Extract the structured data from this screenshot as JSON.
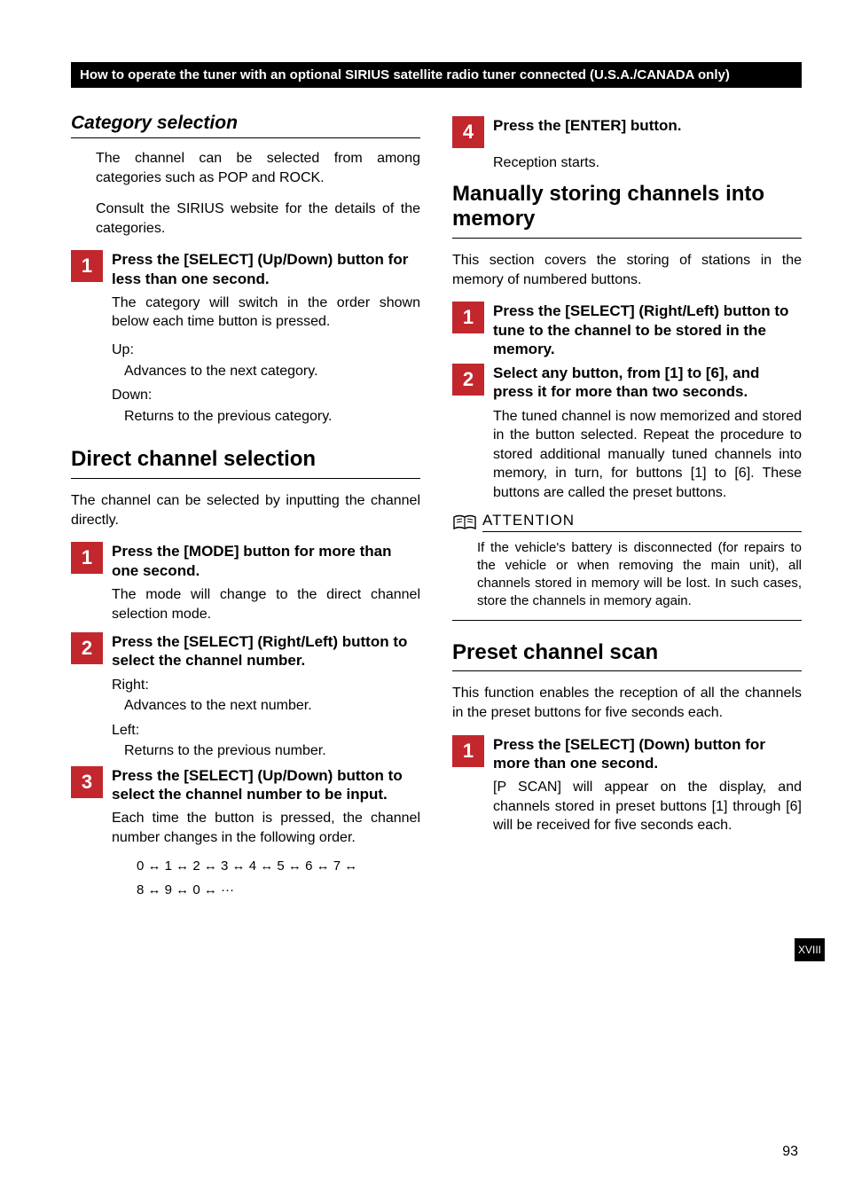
{
  "header": "How to operate the tuner with an optional SIRIUS satellite radio tuner connected (U.S.A./CANADA only)",
  "side_tab": "XVIII",
  "page_number": "93",
  "arrow": "↔",
  "left": {
    "category_selection": {
      "title": "Category selection",
      "intro": "The channel can be selected from among categories such as POP and ROCK.",
      "intro2": "Consult the SIRIUS website for the details of the categories.",
      "step1_num": "1",
      "step1_label": "Press the [SELECT] (Up/Down) button for less than one second.",
      "step1_body": "The category will switch in the order shown below each time button is pressed.",
      "up_label": "Up:",
      "up_body": "Advances to the next category.",
      "down_label": "Down:",
      "down_body": "Returns to the previous category."
    },
    "direct": {
      "title": "Direct channel selection",
      "intro": "The channel can be selected by inputting the channel directly.",
      "step1_num": "1",
      "step1_label": "Press the [MODE] button for more than one second.",
      "step1_body": "The mode will change to the direct channel selection mode.",
      "step2_num": "2",
      "step2_label": "Press the [SELECT] (Right/Left) button to select the channel number.",
      "right_label": "Right:",
      "right_body": "Advances to the next number.",
      "left_label": "Left:",
      "left_body": "Returns to the previous number.",
      "step3_num": "3",
      "step3_label": "Press the [SELECT] (Up/Down) button to select the channel number to be input.",
      "step3_body": "Each time the button is pressed, the channel number changes in the following order.",
      "sequence_line1": "0 ↔ 1 ↔ 2 ↔ 3 ↔ 4 ↔ 5 ↔ 6 ↔ 7 ↔",
      "sequence_line2": "8 ↔ 9 ↔ 0 ↔ ···"
    }
  },
  "right": {
    "step4_num": "4",
    "step4_label": "Press the [ENTER] button.",
    "step4_body": "Reception starts.",
    "manual": {
      "title": "Manually storing channels into memory",
      "intro": "This section covers the storing of stations in the memory of numbered buttons.",
      "step1_num": "1",
      "step1_label": "Press the [SELECT] (Right/Left) button to tune to the channel to be stored in the memory.",
      "step2_num": "2",
      "step2_label": "Select any button, from [1] to [6], and press it for more than two seconds.",
      "step2_body": "The tuned channel is now memorized and stored in the button selected. Repeat the procedure to stored additional manually tuned channels into memory, in turn, for buttons [1] to [6]. These buttons are called the preset buttons."
    },
    "attention": {
      "label": "ATTENTION",
      "body": "If the vehicle's battery is disconnected (for repairs to the vehicle or when removing the main unit), all channels stored in memory will be lost. In such cases, store the channels in memory again."
    },
    "preset": {
      "title": "Preset channel scan",
      "intro": "This function enables the reception of all the channels in the preset buttons for five seconds each.",
      "step1_num": "1",
      "step1_label": "Press the [SELECT] (Down) button for more than one second.",
      "step1_body": "[P SCAN] will appear on the display, and channels stored in preset buttons [1] through [6] will be received for five seconds each."
    }
  }
}
